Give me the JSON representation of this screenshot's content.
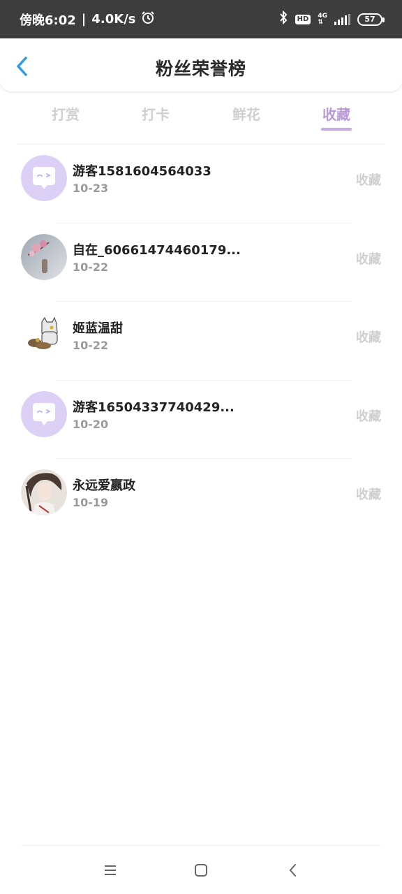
{
  "status_bar": {
    "time": "傍晚6:02",
    "network_speed": "4.0K/s",
    "hd_label": "HD",
    "network_type": "4G",
    "battery": "57"
  },
  "header": {
    "title": "粉丝荣誉榜"
  },
  "tabs": [
    {
      "label": "打赏",
      "active": false
    },
    {
      "label": "打卡",
      "active": false
    },
    {
      "label": "鲜花",
      "active": false
    },
    {
      "label": "收藏",
      "active": true
    }
  ],
  "fans": [
    {
      "name": "游客1581604564033",
      "date": "10-23",
      "action": "收藏",
      "avatar": "default-chat-avatar"
    },
    {
      "name": "自在_60661474460179...",
      "date": "10-22",
      "action": "收藏",
      "avatar": "flower-photo-avatar"
    },
    {
      "name": "姬蓝温甜",
      "date": "10-22",
      "action": "收藏",
      "avatar": "cat-sticker-avatar"
    },
    {
      "name": "游客16504337740429...",
      "date": "10-20",
      "action": "收藏",
      "avatar": "default-chat-avatar"
    },
    {
      "name": "永远爱嬴政",
      "date": "10-19",
      "action": "收藏",
      "avatar": "anime-portrait-avatar"
    }
  ],
  "colors": {
    "accent": "#b99ad6",
    "tab_inactive": "#cfcfcf",
    "status_bar": "#3d3d3d",
    "back_arrow": "#2f9be0",
    "avatar_default": "#d9c7f5"
  },
  "nav": {
    "menu_icon": "menu-icon",
    "home_icon": "home-square-icon",
    "back_icon": "back-chevron-icon"
  }
}
